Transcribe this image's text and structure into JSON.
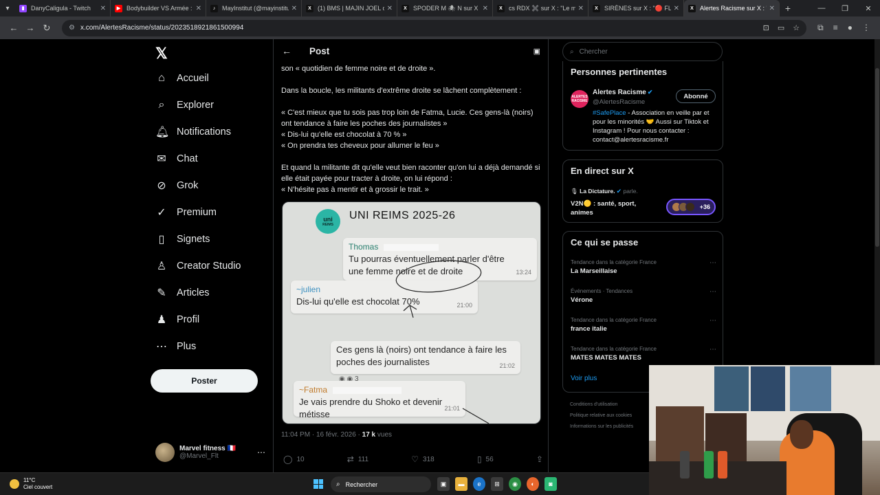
{
  "browser": {
    "tabs": [
      {
        "title": "DanyCaligula - Twitch",
        "fav_color": "#9146ff",
        "fav_glyph": "▮"
      },
      {
        "title": "Bodybuilder VS Armée : q",
        "fav_color": "#ff0000",
        "fav_glyph": "▶"
      },
      {
        "title": "MayInstitut (@mayinstitu",
        "fav_color": "#111111",
        "fav_glyph": "♪"
      },
      {
        "title": "(1) BMS | MAJIN JOEL cr",
        "fav_color": "#111111",
        "fav_glyph": "X"
      },
      {
        "title": "SPODER M 🕷 N sur X : \"A",
        "fav_color": "#111111",
        "fav_glyph": "X"
      },
      {
        "title": "cs RDX ✖️ sur X : \"Le me",
        "fav_color": "#111111",
        "fav_glyph": "X"
      },
      {
        "title": "SIRÈNES sur X : \"🔴 FLAS",
        "fav_color": "#111111",
        "fav_glyph": "X"
      },
      {
        "title": "Alertes Racisme sur X : \"",
        "fav_color": "#111111",
        "fav_glyph": "X"
      }
    ],
    "url": "x.com/AlertesRacisme/status/2023518921861500994"
  },
  "nav": {
    "items": [
      {
        "label": "Accueil",
        "icon": "⌂",
        "name": "home"
      },
      {
        "label": "Explorer",
        "icon": "⌕",
        "name": "explore"
      },
      {
        "label": "Notifications",
        "icon": "🔔︎",
        "name": "notifications"
      },
      {
        "label": "Chat",
        "icon": "✉",
        "name": "chat"
      },
      {
        "label": "Grok",
        "icon": "⊘",
        "name": "grok"
      },
      {
        "label": "Premium",
        "icon": "✓",
        "name": "premium"
      },
      {
        "label": "Signets",
        "icon": "▯",
        "name": "bookmarks"
      },
      {
        "label": "Creator Studio",
        "icon": "♙",
        "name": "creator-studio"
      },
      {
        "label": "Articles",
        "icon": "✎",
        "name": "articles"
      },
      {
        "label": "Profil",
        "icon": "♟",
        "name": "profile"
      },
      {
        "label": "Plus",
        "icon": "⋯",
        "name": "more"
      }
    ],
    "post_button": "Poster",
    "account": {
      "name": "Marvel fitness 🇫🇷",
      "handle": "@Marvel_Flt"
    }
  },
  "post": {
    "header_title": "Post",
    "text": {
      "p1": "son « quotidien de femme noire et de droite ».",
      "p2": "Dans la boucle, les militants d'extrême droite se lâchent complètement :",
      "p3a": "« C'est mieux que tu sois pas trop loin de Fatma, Lucie. Ces gens-là (noirs) ont tendance à faire les poches des journalistes »",
      "p3b": "« Dis-lui qu'elle est chocolat à 70 % »",
      "p3c": "« On prendra tes cheveux pour allumer le feu »",
      "p4a": "Et quand la militante dit qu'elle veut bien raconter qu'on lui a déjà demandé si elle était payée pour tracter à droite, on lui répond :",
      "p4b": "« N'hésite pas à mentir et à grossir le trait. »"
    },
    "image": {
      "logo_text": "uni",
      "logo_sub": "REIMS",
      "title": "UNI REIMS 2025-26",
      "messages": [
        {
          "author": "Thomas",
          "text": "Tu pourras éventuellement parler d'être une femme noire et de droite",
          "time": "13:24"
        },
        {
          "author": "~julien",
          "text": "Dis-lui qu'elle est chocolat 70%",
          "time": "21:00"
        },
        {
          "author": "",
          "text": "Ces gens là (noirs) ont tendance à faire les poches des journalistes",
          "time": "21:02"
        },
        {
          "author": "~Fatma",
          "text": "Je vais prendre du Shoko et devenir métisse",
          "time": "21:01"
        }
      ],
      "reaction_count": "3"
    },
    "meta": {
      "time": "11:04 PM · 16 févr. 2026 · ",
      "views": "17 k",
      "views_label": " vues"
    },
    "actions": {
      "replies": "10",
      "reposts": "111",
      "likes": "318",
      "bookmarks": "56"
    }
  },
  "sidebar": {
    "search_placeholder": "Chercher",
    "relevant": {
      "title": "Personnes pertinentes",
      "name": "Alertes Racisme",
      "handle": "@AlertesRacisme",
      "avatar_text": "ALERTES RACISME",
      "follow_label": "Abonné",
      "bio_tag": "#SafePlace",
      "bio": " - Association en veille par et pour les minorités 🤝 Aussi sur Tiktok et Instagram ! Pour nous contacter : contact@alertesracisme.fr"
    },
    "live": {
      "title": "En direct sur X",
      "host": "La Dictature.",
      "host_suffix": " parle.",
      "space_title": "V2N🟡 : santé, sport, animes",
      "listeners": "+36"
    },
    "trends": {
      "title": "Ce qui se passe",
      "items": [
        {
          "category": "Tendance dans la catégorie France",
          "topic": "La Marseillaise"
        },
        {
          "category": "Événements · Tendances",
          "topic": "Vérone"
        },
        {
          "category": "Tendance dans la catégorie France",
          "topic": "france italie"
        },
        {
          "category": "Tendance dans la catégorie France",
          "topic": "MATES MATES MATES"
        }
      ],
      "more": "Voir plus"
    },
    "footer": [
      "Conditions d'utilisation",
      "Politique relative aux cookies",
      "Informations sur les publicités"
    ]
  },
  "taskbar": {
    "temp": "11°C",
    "weather": "Ciel couvert",
    "search": "Rechercher"
  }
}
